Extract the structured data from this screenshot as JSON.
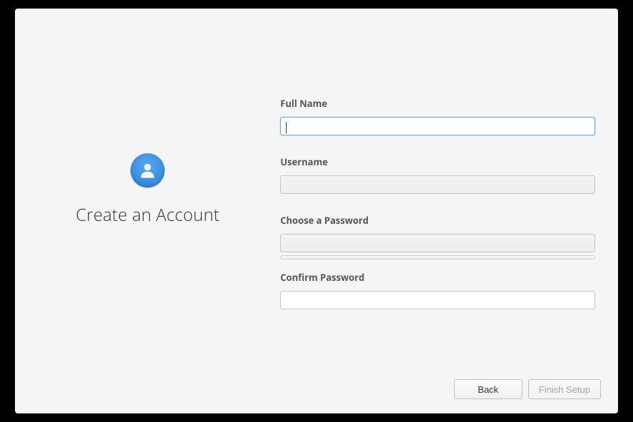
{
  "title": "Create an Account",
  "fields": {
    "full_name": {
      "label": "Full Name",
      "value": ""
    },
    "username": {
      "label": "Username",
      "value": ""
    },
    "password": {
      "label": "Choose a Password",
      "value": ""
    },
    "confirm": {
      "label": "Confirm Password",
      "value": ""
    }
  },
  "buttons": {
    "back": "Back",
    "finish": "Finish Setup"
  }
}
